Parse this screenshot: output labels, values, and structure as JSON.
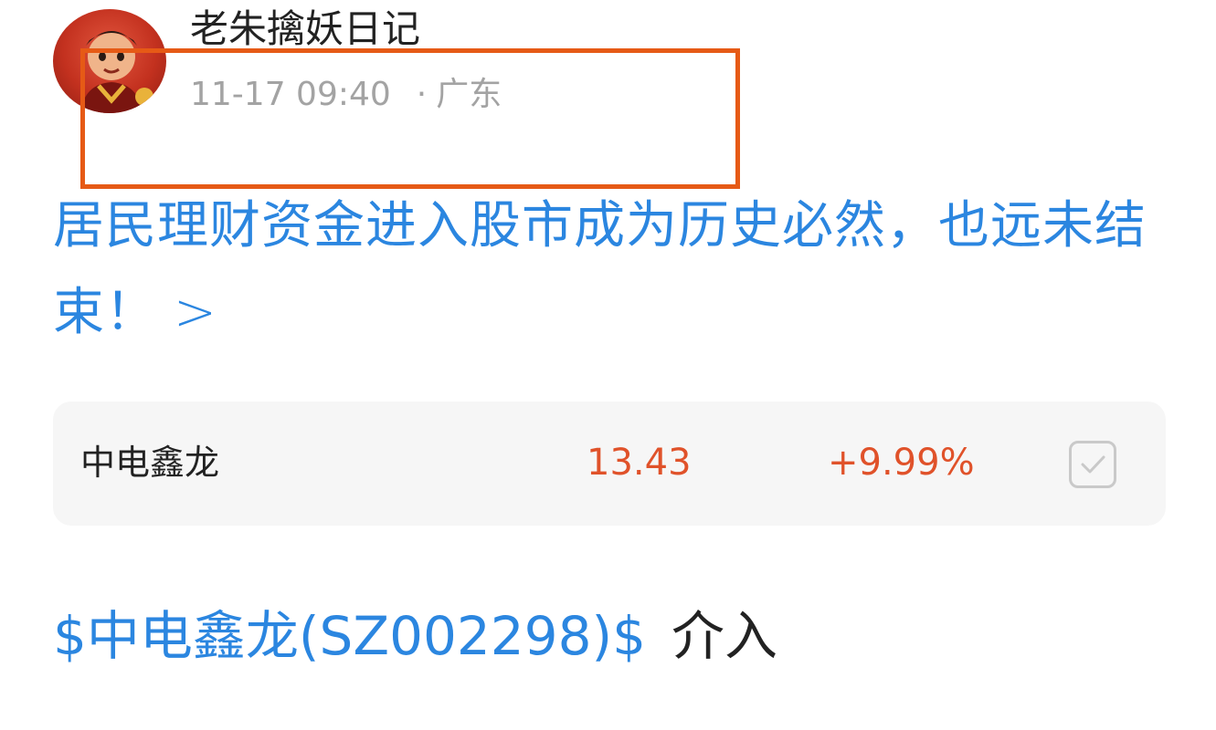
{
  "author": {
    "name": "老朱擒妖日记",
    "post_time": "11-17 09:40",
    "separator": "·",
    "location": "广东"
  },
  "post": {
    "title": "居民理财资金进入股市成为历史必然，也远未结束！",
    "title_arrow": ">"
  },
  "stock_card": {
    "name": "中电鑫龙",
    "price": "13.43",
    "change": "+9.99%",
    "action_icon": "check-icon",
    "price_color": "#e0522a"
  },
  "stock_tag": {
    "label": "$中电鑫龙(SZ002298)$",
    "text": "介入"
  },
  "colors": {
    "link_blue": "#2b86e0",
    "highlight_orange": "#e65a16",
    "card_bg": "#f6f6f6"
  }
}
